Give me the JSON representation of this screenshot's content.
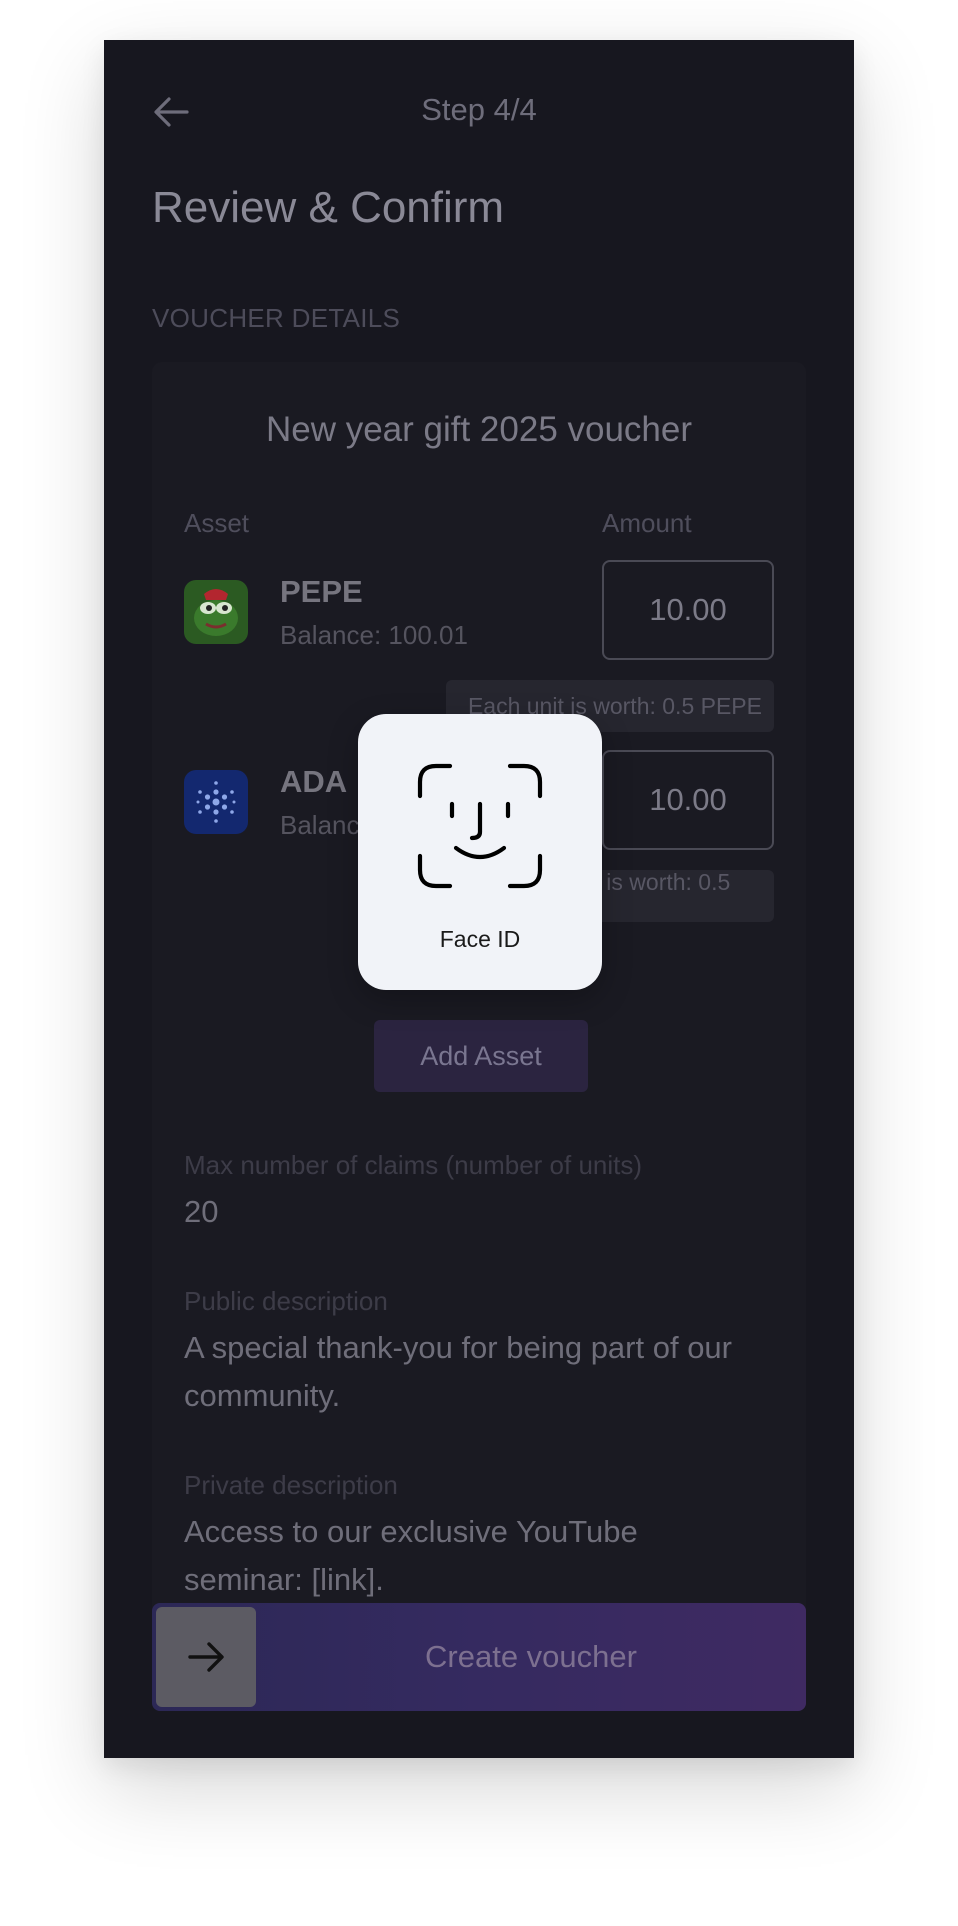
{
  "header": {
    "step": "Step 4/4",
    "title": "Review & Confirm"
  },
  "section_label": "VOUCHER DETAILS",
  "card": {
    "title": "New year gift 2025 voucher",
    "asset_col": "Asset",
    "amount_col": "Amount",
    "assets": [
      {
        "name": "PEPE",
        "balance": "Balance: 100.01",
        "amount": "10.00",
        "note": "Each unit is worth: 0.5 PEPE",
        "icon": "pepe-frog-icon",
        "color": "#3a8a2a"
      },
      {
        "name": "ADA",
        "balance": "Balance: 100.01",
        "amount": "10.00",
        "note": "Each unit is worth: 0.5 ADA",
        "icon": "cardano-icon",
        "color": "#13286f"
      }
    ],
    "add_asset": "Add Asset",
    "claims_label": "Max number of claims (number of units)",
    "claims_value": "20",
    "public_label": "Public description",
    "public_value": "A special thank-you for being part of our community.",
    "private_label": "Private description",
    "private_value": "Access to our exclusive YouTube seminar: [link]."
  },
  "cta": {
    "label": "Create voucher",
    "handle_icon": "arrow-right-icon"
  },
  "faceid": {
    "label": "Face ID",
    "icon": "face-id-icon"
  }
}
